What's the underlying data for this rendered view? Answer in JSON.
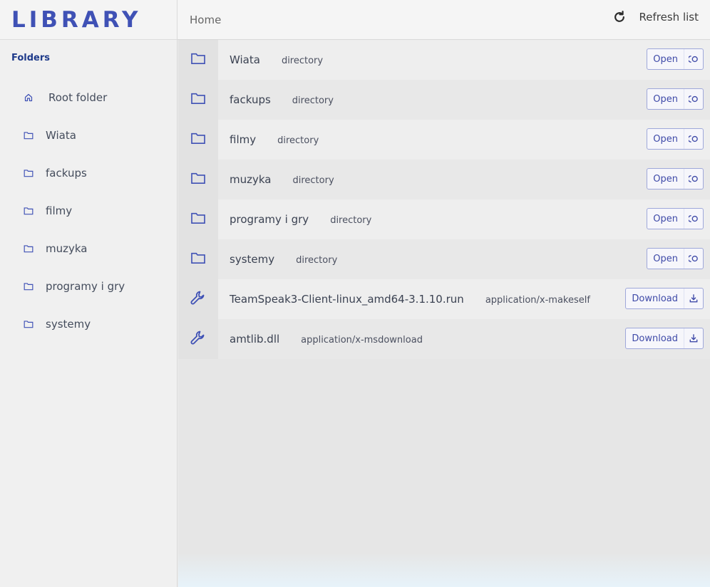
{
  "app": {
    "logo": "LIBRARY"
  },
  "sidebar": {
    "heading": "Folders",
    "items": [
      {
        "label": "Root folder",
        "icon": "home-icon"
      },
      {
        "label": "Wiata",
        "icon": "folder-icon"
      },
      {
        "label": "fackups",
        "icon": "folder-icon"
      },
      {
        "label": "filmy",
        "icon": "folder-icon"
      },
      {
        "label": "muzyka",
        "icon": "folder-icon"
      },
      {
        "label": "programy i gry",
        "icon": "folder-icon"
      },
      {
        "label": "systemy",
        "icon": "folder-icon"
      }
    ]
  },
  "topbar": {
    "breadcrumb": "Home",
    "refresh_label": "Refresh list",
    "refresh_icon": "refresh-icon"
  },
  "files": [
    {
      "name": "Wiata",
      "type": "directory",
      "icon": "folder-icon",
      "action": "Open",
      "action_icon": "open-icon"
    },
    {
      "name": "fackups",
      "type": "directory",
      "icon": "folder-icon",
      "action": "Open",
      "action_icon": "open-icon"
    },
    {
      "name": "filmy",
      "type": "directory",
      "icon": "folder-icon",
      "action": "Open",
      "action_icon": "open-icon"
    },
    {
      "name": "muzyka",
      "type": "directory",
      "icon": "folder-icon",
      "action": "Open",
      "action_icon": "open-icon"
    },
    {
      "name": "programy i gry",
      "type": "directory",
      "icon": "folder-icon",
      "action": "Open",
      "action_icon": "open-icon"
    },
    {
      "name": "systemy",
      "type": "directory",
      "icon": "folder-icon",
      "action": "Open",
      "action_icon": "open-icon"
    },
    {
      "name": "TeamSpeak3-Client-linux_amd64-3.1.10.run",
      "type": "application/x-makeself",
      "icon": "wrench-icon",
      "action": "Download",
      "action_icon": "download-icon"
    },
    {
      "name": "amtlib.dll",
      "type": "application/x-msdownload",
      "icon": "wrench-icon",
      "action": "Download",
      "action_icon": "download-icon"
    }
  ],
  "colors": {
    "accent": "#3f51b5",
    "heading": "#1e3a8a"
  }
}
